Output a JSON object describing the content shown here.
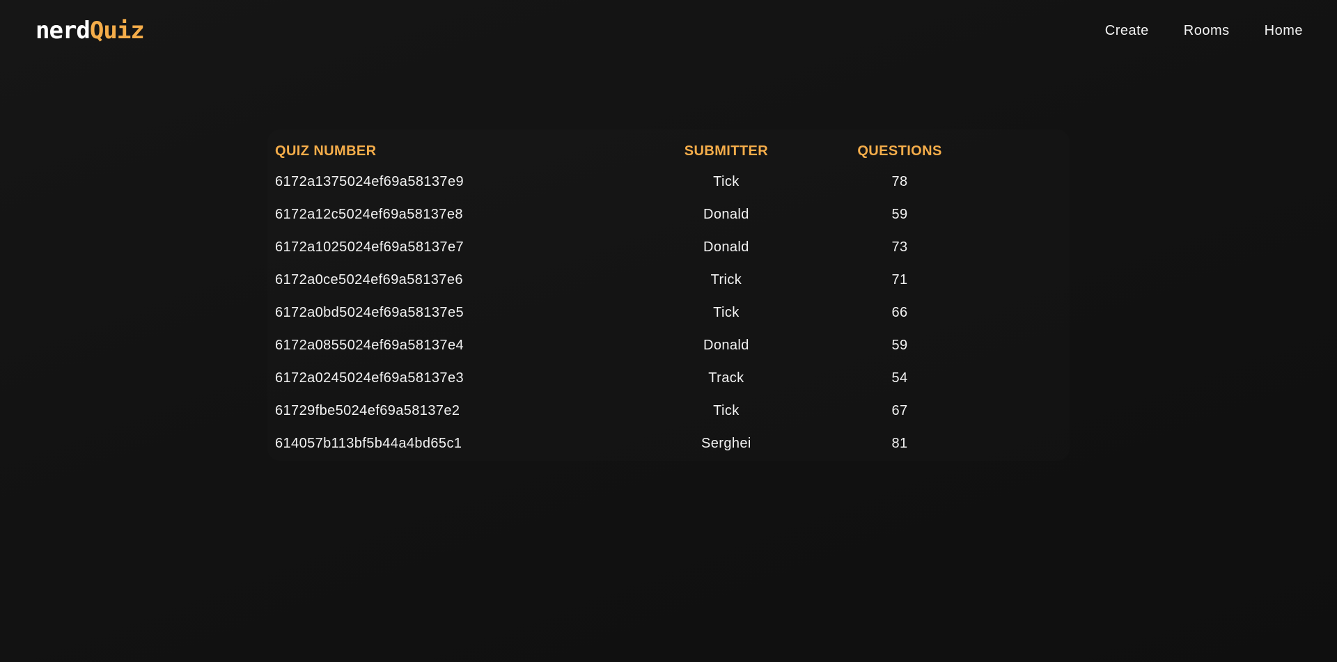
{
  "brand": {
    "part1": "nerd",
    "part2": "Quiz"
  },
  "nav": {
    "create": "Create",
    "rooms": "Rooms",
    "home": "Home"
  },
  "table": {
    "headers": {
      "quiz_number": "QUIZ NUMBER",
      "submitter": "SUBMITTER",
      "questions": "QUESTIONS"
    },
    "rows": [
      {
        "id": "6172a1375024ef69a58137e9",
        "submitter": "Tick",
        "questions": "78"
      },
      {
        "id": "6172a12c5024ef69a58137e8",
        "submitter": "Donald",
        "questions": "59"
      },
      {
        "id": "6172a1025024ef69a58137e7",
        "submitter": "Donald",
        "questions": "73"
      },
      {
        "id": "6172a0ce5024ef69a58137e6",
        "submitter": "Trick",
        "questions": "71"
      },
      {
        "id": "6172a0bd5024ef69a58137e5",
        "submitter": "Tick",
        "questions": "66"
      },
      {
        "id": "6172a0855024ef69a58137e4",
        "submitter": "Donald",
        "questions": "59"
      },
      {
        "id": "6172a0245024ef69a58137e3",
        "submitter": "Track",
        "questions": "54"
      },
      {
        "id": "61729fbe5024ef69a58137e2",
        "submitter": "Tick",
        "questions": "67"
      },
      {
        "id": "614057b113bf5b44a4bd65c1",
        "submitter": "Serghei",
        "questions": "81"
      }
    ]
  },
  "colors": {
    "accent": "#f5ad4a",
    "background": "#121212",
    "text": "#f2f2f2"
  }
}
